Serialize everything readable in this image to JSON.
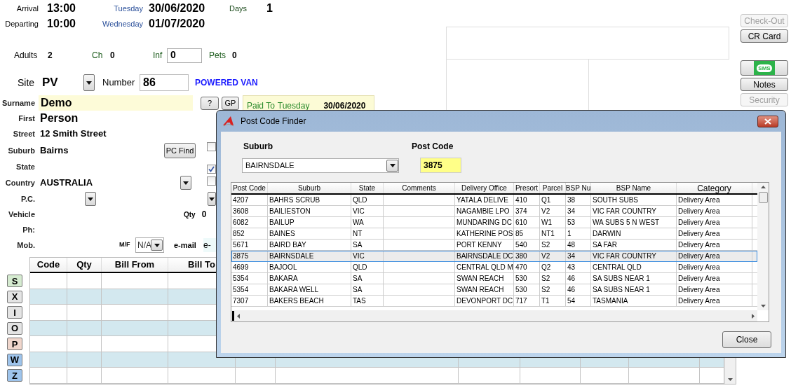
{
  "dates": [
    {
      "label": "Arrival",
      "time": "13:00",
      "day": "Tuesday",
      "date": "30/06/2020"
    },
    {
      "label": "Departing",
      "time": "10:00",
      "day": "Wednesday",
      "date": "01/07/2020"
    }
  ],
  "days": {
    "label": "Days",
    "value": "1"
  },
  "guests": {
    "adults": {
      "label": "Adults",
      "value": "2"
    },
    "ch": {
      "label": "Ch",
      "value": "0"
    },
    "inf": {
      "label": "Inf",
      "value": "0"
    },
    "pets": {
      "label": "Pets",
      "value": "0"
    }
  },
  "site": {
    "label": "Site",
    "value": "PV",
    "number_label": "Number",
    "number": "86",
    "type": "POWERED VAN"
  },
  "contact": {
    "surname": {
      "label": "Surname",
      "value": "Demo"
    },
    "first": {
      "label": "First",
      "value": "Person"
    },
    "street": {
      "label": "Street",
      "value": "12 Smith Street"
    },
    "suburb": {
      "label": "Suburb",
      "value": "Bairns"
    },
    "state": {
      "label": "State"
    },
    "country": {
      "label": "Country",
      "value": "AUSTRALIA"
    },
    "pc": {
      "label": "P.C."
    },
    "vehicle": {
      "label": "Vehicle"
    },
    "ph": {
      "label": "Ph:"
    },
    "mob": {
      "label": "Mob."
    }
  },
  "help_button": "?",
  "gp_button": "GP",
  "pc_find_button": "PC Find",
  "checkboxes": [
    {
      "checked": false
    },
    {
      "checked": true
    },
    {
      "checked": false
    }
  ],
  "paid_to": {
    "label": "Paid To",
    "day": "Tuesday",
    "date": "30/06/2020"
  },
  "qty": {
    "label": "Qty",
    "value": "0"
  },
  "mf": {
    "label": "M/F",
    "value": "N/A"
  },
  "email": {
    "label": "e-mail",
    "value": "e-"
  },
  "charges_table": {
    "columns": [
      "Code",
      "Qty",
      "Bill From",
      "Bill To"
    ]
  },
  "row_buttons": [
    {
      "label": "S",
      "color": "#d5ebd0"
    },
    {
      "label": "X",
      "color": "#e4e4e4"
    },
    {
      "label": "I",
      "color": "#e4e4e4"
    },
    {
      "label": "O",
      "color": "#e4e4e4"
    },
    {
      "label": "P",
      "color": "#f0d6cc"
    },
    {
      "label": "W",
      "color": "#9ec4ec"
    },
    {
      "label": "Z",
      "color": "#9ec4ec"
    }
  ],
  "side_buttons": [
    {
      "kind": "text",
      "label": "Check-Out",
      "disabled": true
    },
    {
      "kind": "text",
      "label": "CR Card",
      "disabled": false
    },
    {
      "kind": "sms",
      "label": "SMS",
      "disabled": false
    },
    {
      "kind": "text",
      "label": "Notes",
      "disabled": false
    },
    {
      "kind": "text",
      "label": "Security",
      "disabled": true
    }
  ],
  "dialog": {
    "title": "Post Code Finder",
    "suburb_label": "Suburb",
    "suburb": "BAIRNSDALE",
    "postcode_label": "Post Code",
    "postcode": "3875",
    "columns": [
      "Post Code",
      "Suburb",
      "State",
      "Comments",
      "Delivery Office",
      "Presort",
      "Parcel",
      "BSP Nu",
      "BSP Name",
      "Category"
    ],
    "rows": [
      {
        "cells": [
          "4207",
          "BAHRS SCRUB",
          "QLD",
          "",
          "YATALA DELIVE",
          "410",
          "Q1",
          "38",
          "SOUTH SUBS",
          "Delivery Area"
        ],
        "selected": false
      },
      {
        "cells": [
          "3608",
          "BAILIESTON",
          "VIC",
          "",
          "NAGAMBIE LPO",
          "374",
          "V2",
          "34",
          "VIC FAR COUNTRY",
          "Delivery Area"
        ],
        "selected": false
      },
      {
        "cells": [
          "6082",
          "BAILUP",
          "WA",
          "",
          "MUNDARING DC",
          "610",
          "W1",
          "53",
          "WA SUBS 5 N WEST",
          "Delivery Area"
        ],
        "selected": false
      },
      {
        "cells": [
          "852",
          "BAINES",
          "NT",
          "",
          "KATHERINE POS",
          "85",
          "NT1",
          "1",
          "DARWIN",
          "Delivery Area"
        ],
        "selected": false
      },
      {
        "cells": [
          "5671",
          "BAIRD BAY",
          "SA",
          "",
          "PORT KENNY",
          "540",
          "S2",
          "48",
          "SA FAR",
          "Delivery Area"
        ],
        "selected": false
      },
      {
        "cells": [
          "3875",
          "BAIRNSDALE",
          "VIC",
          "",
          "BAIRNSDALE DC",
          "380",
          "V2",
          "34",
          "VIC FAR COUNTRY",
          "Delivery Area"
        ],
        "selected": true
      },
      {
        "cells": [
          "4699",
          "BAJOOL",
          "QLD",
          "",
          "CENTRAL QLD M",
          "470",
          "Q2",
          "43",
          "CENTRAL QLD",
          "Delivery Area"
        ],
        "selected": false
      },
      {
        "cells": [
          "5354",
          "BAKARA",
          "SA",
          "",
          "SWAN REACH",
          "530",
          "S2",
          "46",
          "SA SUBS NEAR 1",
          "Delivery Area"
        ],
        "selected": false
      },
      {
        "cells": [
          "5354",
          "BAKARA WELL",
          "SA",
          "",
          "SWAN REACH",
          "530",
          "S2",
          "46",
          "SA SUBS NEAR 1",
          "Delivery Area"
        ],
        "selected": false
      },
      {
        "cells": [
          "7307",
          "BAKERS BEACH",
          "TAS",
          "",
          "DEVONPORT DC",
          "717",
          "T1",
          "54",
          "TASMANIA",
          "Delivery Area"
        ],
        "selected": false
      }
    ],
    "close": "Close"
  }
}
